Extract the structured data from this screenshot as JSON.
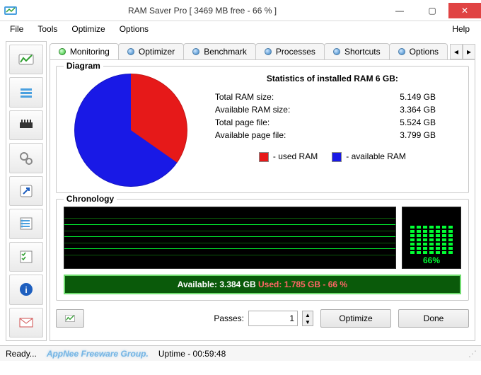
{
  "window": {
    "title": "RAM Saver Pro [ 3469 MB free - 66 % ]"
  },
  "menu": {
    "file": "File",
    "tools": "Tools",
    "optimize": "Optimize",
    "options": "Options",
    "help": "Help"
  },
  "tabs": {
    "monitoring": "Monitoring",
    "optimizer": "Optimizer",
    "benchmark": "Benchmark",
    "processes": "Processes",
    "shortcuts": "Shortcuts",
    "options": "Options"
  },
  "diagram": {
    "legend": "Diagram",
    "stats_title": "Statistics of installed RAM 6 GB:",
    "rows": [
      {
        "label": "Total RAM size:",
        "value": "5.149 GB"
      },
      {
        "label": "Available RAM size:",
        "value": "3.364 GB"
      },
      {
        "label": "Total page file:",
        "value": "5.524 GB"
      },
      {
        "label": "Available page file:",
        "value": "3.799 GB"
      }
    ],
    "used_label": "- used RAM",
    "avail_label": "- available RAM"
  },
  "chron": {
    "legend": "Chronology",
    "pct": "66%",
    "bar_text_a": "Available: 3.384 GB  ",
    "bar_text_b": "Used: 1.785 GB - 66 %"
  },
  "bottom": {
    "passes_label": "Passes:",
    "passes_value": "1",
    "optimize": "Optimize",
    "done": "Done"
  },
  "status": {
    "ready": "Ready...",
    "watermark": "AppNee Freeware Group.",
    "uptime": "Uptime - 00:59:48"
  },
  "chart_data": {
    "type": "pie",
    "title": "RAM usage",
    "series": [
      {
        "name": "used RAM",
        "value": 1.785,
        "color": "#e61919"
      },
      {
        "name": "available RAM",
        "value": 3.364,
        "color": "#1919e6"
      }
    ],
    "percent_available": 66
  }
}
